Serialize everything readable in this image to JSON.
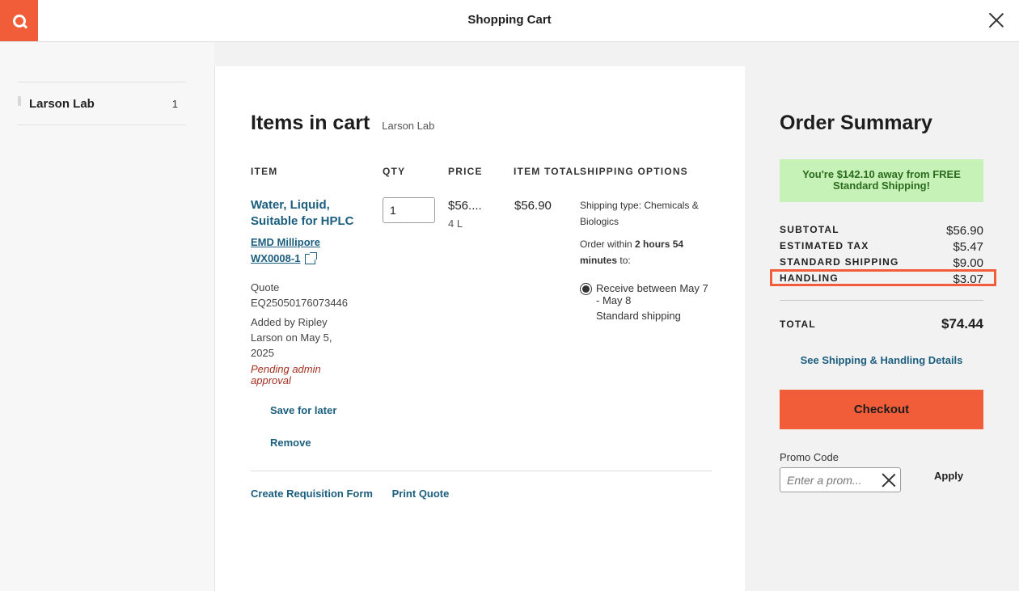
{
  "header": {
    "title": "Shopping Cart",
    "logo_icon": "search-logo-icon",
    "close_icon": "close-icon"
  },
  "sidebar": {
    "items": [
      {
        "label": "Larson Lab",
        "count": "1"
      }
    ]
  },
  "cart": {
    "title": "Items in cart",
    "subtitle": "Larson Lab",
    "columns": [
      "ITEM",
      "QTY",
      "PRICE",
      "ITEM TOTAL",
      "SHIPPING OPTIONS"
    ],
    "items": [
      {
        "name": "Water, Liquid, Suitable for HPLC",
        "brand": "EMD Millipore",
        "sku": "WX0008-1",
        "quote_label": "Quote",
        "quote_number": "EQ25050176073446",
        "added_by": "Added by Ripley Larson on May 5, 2025",
        "status": "Pending admin approval",
        "qty": "1",
        "price": "$56....",
        "unit": "4 L",
        "item_total": "$56.90",
        "shipping_type": "Shipping type: Chemicals & Biologics",
        "order_within_prefix": "Order within",
        "order_within_time": "2 hours 54 minutes",
        "order_within_suffix": "to:",
        "delivery_window": "Receive between May 7 - May 8",
        "delivery_method": "Standard shipping",
        "save_for_later": "Save for later",
        "remove": "Remove"
      }
    ],
    "footer_links": [
      "Create Requisition Form",
      "Print Quote"
    ]
  },
  "summary": {
    "title": "Order Summary",
    "banner": "You're $142.10 away from FREE Standard Shipping!",
    "rows": [
      {
        "label": "SUBTOTAL",
        "value": "$56.90"
      },
      {
        "label": "ESTIMATED TAX",
        "value": "$5.47"
      },
      {
        "label": "STANDARD SHIPPING",
        "value": "$9.00"
      },
      {
        "label": "HANDLING",
        "value": "$3.07"
      }
    ],
    "total_label": "TOTAL",
    "total_value": "$74.44",
    "details_link": "See Shipping & Handling Details",
    "checkout_label": "Checkout",
    "promo_label": "Promo Code",
    "promo_placeholder": "Enter a prom...",
    "promo_value": "",
    "apply_label": "Apply"
  },
  "colors": {
    "accent": "#f05d38",
    "link": "#1b5e7e",
    "banner_bg": "#c6f1b7",
    "pending": "#a3301f"
  }
}
